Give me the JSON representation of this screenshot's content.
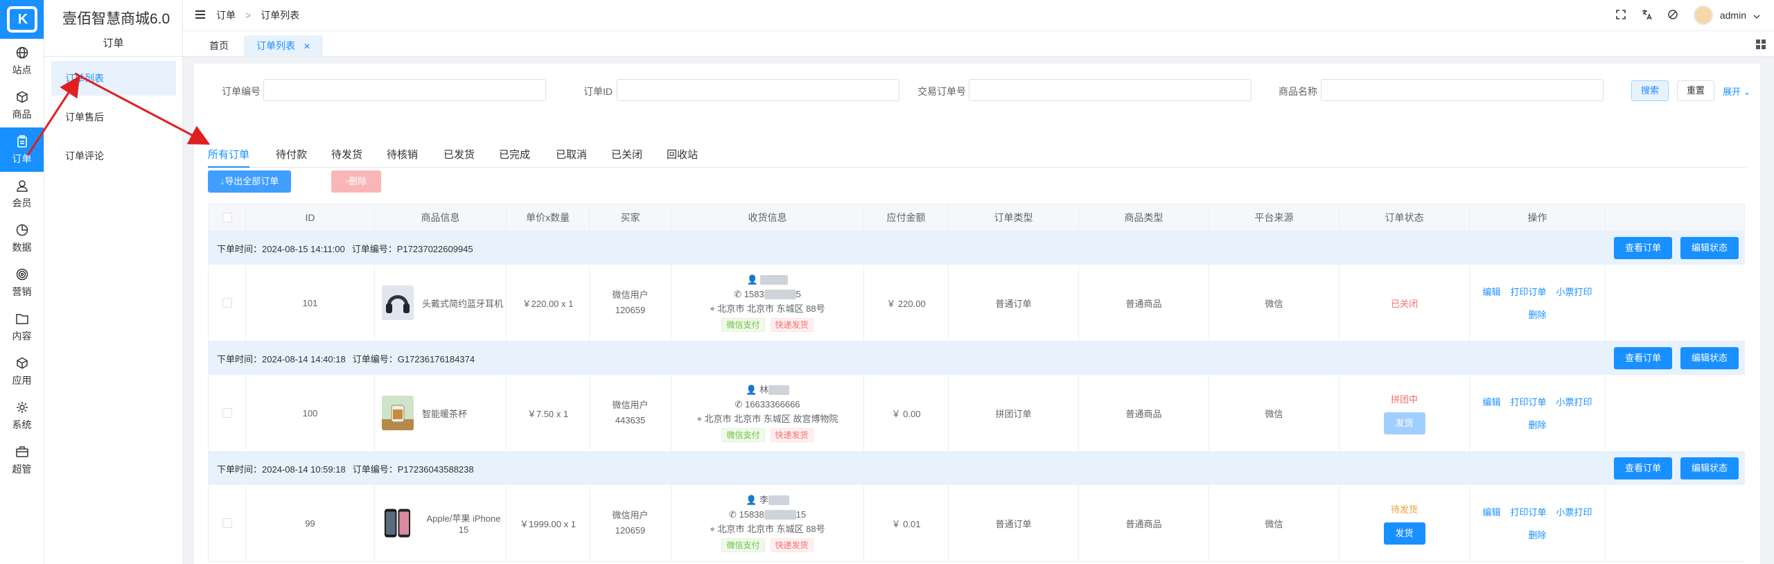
{
  "app": {
    "title": "壹佰智慧商城6.0",
    "section": "订单"
  },
  "rail": [
    {
      "label": "站点",
      "icon": "globe-icon"
    },
    {
      "label": "商品",
      "icon": "box-icon"
    },
    {
      "label": "订单",
      "icon": "clipboard-icon",
      "active": true
    },
    {
      "label": "会员",
      "icon": "user-icon"
    },
    {
      "label": "数据",
      "icon": "pie-chart-icon"
    },
    {
      "label": "营销",
      "icon": "target-icon"
    },
    {
      "label": "内容",
      "icon": "folder-icon"
    },
    {
      "label": "应用",
      "icon": "cube-icon"
    },
    {
      "label": "系统",
      "icon": "gear-icon"
    },
    {
      "label": "超管",
      "icon": "briefcase-icon"
    }
  ],
  "subnav": [
    {
      "label": "订单列表",
      "active": true
    },
    {
      "label": "订单售后"
    },
    {
      "label": "订单评论"
    }
  ],
  "header": {
    "breadcrumb": [
      "订单",
      "订单列表"
    ],
    "user": "admin"
  },
  "pagetabs": {
    "home": "首页",
    "current": "订单列表"
  },
  "filters": {
    "order_no": {
      "label": "订单编号",
      "value": ""
    },
    "order_id": {
      "label": "订单ID",
      "value": ""
    },
    "trade_no": {
      "label": "交易订单号",
      "value": ""
    },
    "goods_name": {
      "label": "商品名称",
      "value": ""
    },
    "search": "搜索",
    "reset": "重置",
    "expand": "展开"
  },
  "order_tabs": [
    "所有订单",
    "待付款",
    "待发货",
    "待核销",
    "已发货",
    "已完成",
    "已取消",
    "已关闭",
    "回收站"
  ],
  "actions": {
    "export": "导出全部订单",
    "delete": "删除"
  },
  "columns": [
    "ID",
    "商品信息",
    "单价x数量",
    "买家",
    "收货信息",
    "应付金额",
    "订单类型",
    "商品类型",
    "平台来源",
    "订单状态",
    "操作"
  ],
  "group_buttons": {
    "view": "查看订单",
    "edit_status": "编辑状态"
  },
  "ops_labels": {
    "edit": "编辑",
    "print": "打印订单",
    "ticket": "小票打印",
    "delete": "删除"
  },
  "orders": [
    {
      "group_time_label": "下单时间：2024-08-15 14:11:00",
      "group_no_label": "订单编号：P17237022609945",
      "id": "101",
      "goods": "头戴式简约蓝牙耳机",
      "price_qty": "￥220.00 x 1",
      "buyer_line1": "微信用户",
      "buyer_line2": "120659",
      "name": "",
      "phone": "1583",
      "phone_tail": "5",
      "address": "北京市 北京市 东城区 88号",
      "pay_tag": "微信支付",
      "ship_tag": "快递发货",
      "amount": "￥ 220.00",
      "order_type": "普通订单",
      "goods_type": "普通商品",
      "platform": "微信",
      "status": "已关闭",
      "status_color": "#f56c6c",
      "ship_button": ""
    },
    {
      "group_time_label": "下单时间：2024-08-14 14:40:18",
      "group_no_label": "订单编号：G17236176184374",
      "id": "100",
      "goods": "智能暖茶杯",
      "price_qty": "￥7.50 x 1",
      "buyer_line1": "微信用户",
      "buyer_line2": "443635",
      "name": "林",
      "phone": "16633366666",
      "phone_tail": "",
      "address": "北京市 北京市 东城区 故宫博物院",
      "pay_tag": "微信支付",
      "ship_tag": "快递发货",
      "amount": "￥ 0.00",
      "order_type": "拼团订单",
      "goods_type": "普通商品",
      "platform": "微信",
      "status": "拼团中",
      "status_color": "#f56c6c",
      "ship_button": "发货",
      "ship_button_color": "#a0cfff"
    },
    {
      "group_time_label": "下单时间：2024-08-14 10:59:18",
      "group_no_label": "订单编号：P17236043588238",
      "id": "99",
      "goods": "Apple/苹果 iPhone 15",
      "price_qty": "￥1999.00 x 1",
      "buyer_line1": "微信用户",
      "buyer_line2": "120659",
      "name": "李",
      "phone": "15838",
      "phone_tail": "15",
      "address": "北京市 北京市 东城区 88号",
      "pay_tag": "微信支付",
      "ship_tag": "快递发货",
      "amount": "￥ 0.01",
      "order_type": "普通订单",
      "goods_type": "普通商品",
      "platform": "微信",
      "status": "待发货",
      "status_color": "#e6a23c",
      "ship_button": "发货",
      "ship_button_color": "#1890ff"
    }
  ],
  "colors": {
    "primary": "#1890ff",
    "annotation_arrow": "#e02020"
  }
}
